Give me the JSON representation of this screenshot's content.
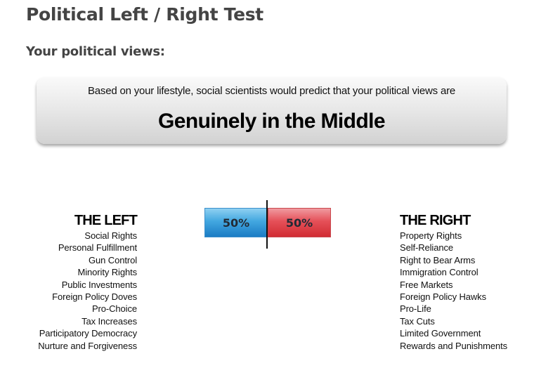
{
  "page": {
    "title": "Political Left / Right Test",
    "section_title": "Your political views:"
  },
  "result": {
    "intro": "Based on your lifestyle, social scientists would predict that your political views are",
    "value": "Genuinely in the Middle"
  },
  "meter": {
    "left_percent": 50,
    "right_percent": 50,
    "left_label": "50%",
    "right_label": "50%",
    "left_color": "#2e92d6",
    "right_color": "#dd3d44"
  },
  "left": {
    "heading": "THE LEFT",
    "items": [
      "Social Rights",
      "Personal Fulfillment",
      "Gun Control",
      "Minority Rights",
      "Public Investments",
      "Foreign Policy Doves",
      "Pro-Choice",
      "Tax Increases",
      "Participatory Democracy",
      "Nurture and Forgiveness"
    ]
  },
  "right": {
    "heading": "THE RIGHT",
    "items": [
      "Property Rights",
      "Self-Reliance",
      "Right to Bear Arms",
      "Immigration Control",
      "Free Markets",
      "Foreign Policy Hawks",
      "Pro-Life",
      "Tax Cuts",
      "Limited Government",
      "Rewards and Punishments"
    ]
  }
}
